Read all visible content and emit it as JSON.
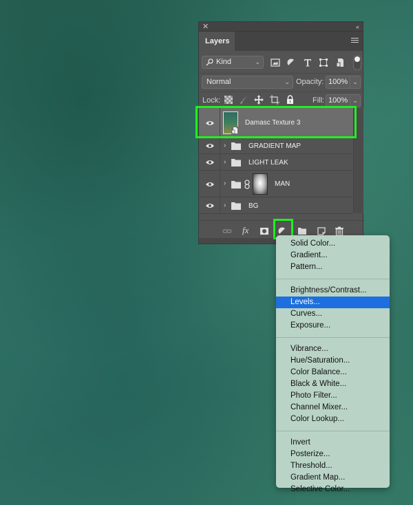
{
  "panel": {
    "tab_label": "Layers",
    "filter": {
      "kind_label": "Kind"
    },
    "blend_mode": "Normal",
    "opacity_label": "Opacity:",
    "opacity_value": "100%",
    "lock_label": "Lock:",
    "fill_label": "Fill:",
    "fill_value": "100%",
    "layers": [
      {
        "name": "Damasc Texture 3",
        "type": "smart-object",
        "visible": true,
        "selected": true
      },
      {
        "name": "GRADIENT MAP",
        "type": "group",
        "visible": true,
        "selected": false
      },
      {
        "name": "LIGHT LEAK",
        "type": "group",
        "visible": true,
        "selected": false
      },
      {
        "name": "MAN",
        "type": "group-with-mask",
        "visible": true,
        "selected": false
      },
      {
        "name": "BG",
        "type": "group",
        "visible": true,
        "selected": false
      }
    ]
  },
  "adjustment_menu": {
    "groups": [
      [
        "Solid Color...",
        "Gradient...",
        "Pattern..."
      ],
      [
        "Brightness/Contrast...",
        "Levels...",
        "Curves...",
        "Exposure..."
      ],
      [
        "Vibrance...",
        "Hue/Saturation...",
        "Color Balance...",
        "Black & White...",
        "Photo Filter...",
        "Channel Mixer...",
        "Color Lookup..."
      ],
      [
        "Invert",
        "Posterize...",
        "Threshold...",
        "Gradient Map...",
        "Selective Color..."
      ]
    ],
    "highlighted_item": "Levels...",
    "highlight_color": "#1d6fe0"
  },
  "colors": {
    "annotation_highlight": "#22ee22",
    "panel_bg": "#535353",
    "selected_layer_bg": "#6d6d6d"
  }
}
